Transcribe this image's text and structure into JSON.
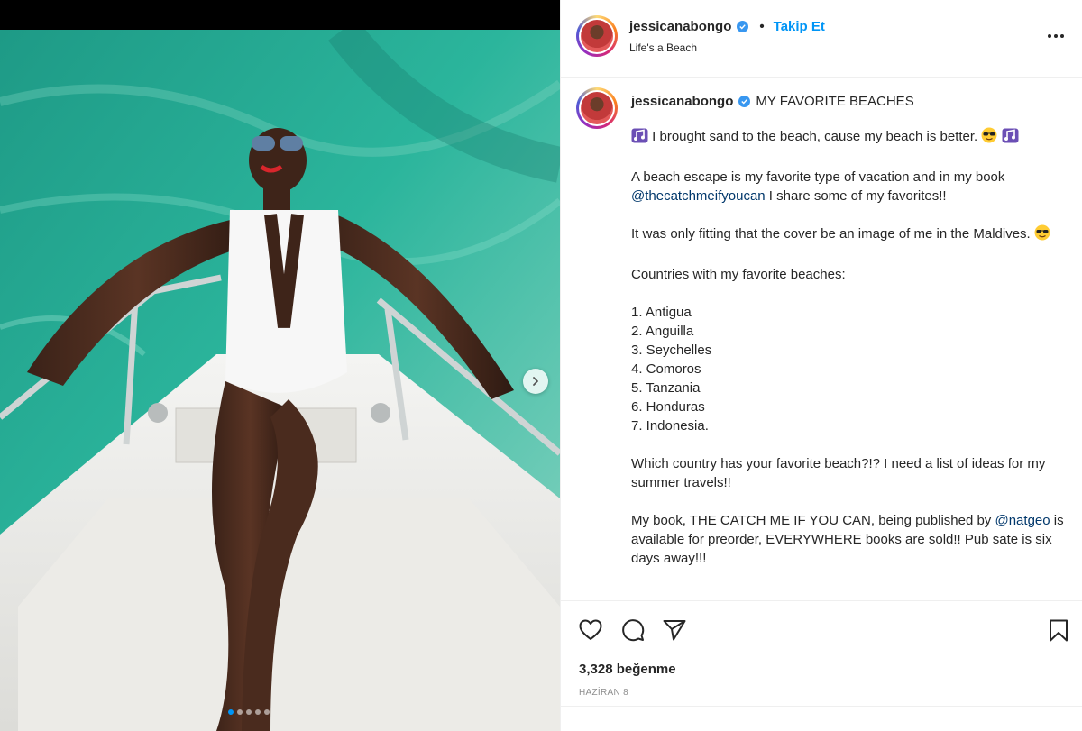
{
  "post": {
    "username": "jessicanabongo",
    "follow_label": "Takip Et",
    "separator": "•",
    "location": "Life's a Beach"
  },
  "caption": {
    "username": "jessicanabongo",
    "title": "MY FAVORITE BEACHES",
    "line1_text": " I brought sand to the beach, cause my beach is better. ",
    "p2_a": "A beach escape is my favorite type of vacation and in my book ",
    "p2_mention": "@thecatchmeifyoucan",
    "p2_b": " I share some of my favorites!!",
    "p3": "It was only fitting that the cover be an image of me in the Maldives. ",
    "p4": "Countries with my favorite beaches:",
    "countries": [
      "1. Antigua",
      "2. Anguilla",
      "3. Seychelles",
      "4. Comoros",
      "5. Tanzania",
      "6. Honduras",
      "7. Indonesia."
    ],
    "p6": "Which country has your favorite beach?!? I need a list of ideas for my summer travels!!",
    "p7_a": "My book, THE CATCH ME IF YOU CAN, being published by ",
    "p7_mention": "@natgeo",
    "p7_b": " is available for preorder, EVERYWHERE books are sold!! Pub sate is six days away!!!"
  },
  "stats": {
    "likes": "3,328 beğenme",
    "date": "HAZİRAN 8"
  },
  "carousel": {
    "slide_count": 5,
    "active_slide": 1
  },
  "colors": {
    "accent": "#0095f6",
    "mention": "#00376b",
    "verified": "#3897f0"
  },
  "icons": {
    "like": "heart-icon",
    "comment": "comment-icon",
    "share": "paper-plane-icon",
    "save": "bookmark-icon",
    "more": "more-options-icon",
    "next": "chevron-right-icon"
  }
}
